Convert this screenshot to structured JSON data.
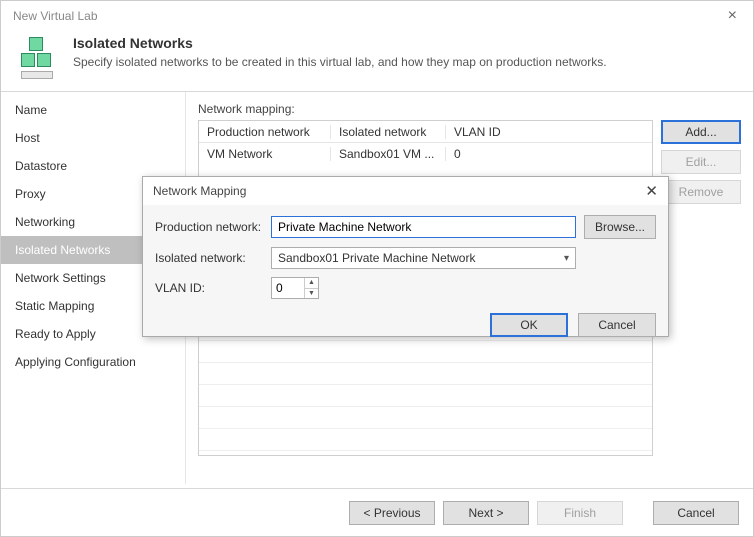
{
  "window": {
    "title": "New Virtual Lab"
  },
  "header": {
    "title": "Isolated Networks",
    "description": "Specify isolated networks to be created in this virtual lab, and how they map on production networks."
  },
  "sidebar": {
    "items": [
      {
        "label": "Name"
      },
      {
        "label": "Host"
      },
      {
        "label": "Datastore"
      },
      {
        "label": "Proxy"
      },
      {
        "label": "Networking"
      },
      {
        "label": "Isolated Networks",
        "selected": true
      },
      {
        "label": "Network Settings"
      },
      {
        "label": "Static Mapping"
      },
      {
        "label": "Ready to Apply"
      },
      {
        "label": "Applying Configuration"
      }
    ]
  },
  "main": {
    "section_label": "Network mapping:",
    "columns": {
      "prod": "Production network",
      "iso": "Isolated network",
      "vlan": "VLAN ID"
    },
    "rows": [
      {
        "prod": "VM Network",
        "iso": "Sandbox01 VM ...",
        "vlan": "0"
      }
    ],
    "buttons": {
      "add": "Add...",
      "edit": "Edit...",
      "remove": "Remove"
    }
  },
  "footer": {
    "previous": "< Previous",
    "next": "Next >",
    "finish": "Finish",
    "cancel": "Cancel"
  },
  "modal": {
    "title": "Network Mapping",
    "labels": {
      "production": "Production network:",
      "isolated": "Isolated network:",
      "vlan": "VLAN ID:"
    },
    "values": {
      "production": "Private Machine Network",
      "isolated": "Sandbox01 Private Machine Network",
      "vlan": "0"
    },
    "buttons": {
      "browse": "Browse...",
      "ok": "OK",
      "cancel": "Cancel"
    }
  }
}
